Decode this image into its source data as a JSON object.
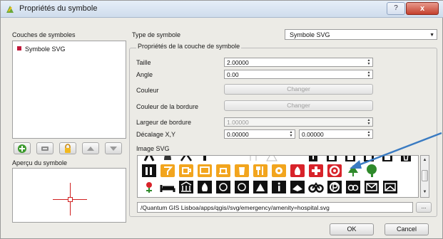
{
  "window": {
    "title": "Propriétés du symbole",
    "help_label": "?",
    "close_label": "x"
  },
  "left": {
    "layers_title": "Couches de symboles",
    "layers": [
      {
        "label": "Symbole SVG",
        "color": "#c0183a"
      }
    ],
    "tools": [
      "add-icon",
      "remove-icon",
      "lock-icon",
      "move-up-icon",
      "move-down-icon"
    ],
    "preview_title": "Aperçu du symbole"
  },
  "right": {
    "type_label": "Type de symbole",
    "type_value": "Symbole SVG",
    "layer_props_title": "Propriétés de la couche de symbole",
    "fields": {
      "size_label": "Taille",
      "size_value": "2.00000",
      "angle_label": "Angle",
      "angle_value": "0.00",
      "color_label": "Couleur",
      "color_button": "Changer",
      "border_color_label": "Couleur de la bordure",
      "border_color_button": "Changer",
      "border_width_label": "Largeur de bordure",
      "border_width_value": "1.00000",
      "offset_label": "Décalage X,Y",
      "offset_x": "0.00000",
      "offset_y": "0.00000"
    },
    "svg_image_label": "Image SVG",
    "svg_path": "/Quantum GIS Lisboa/apps/qgis//svg/emergency/amenity=hospital.svg",
    "browse_label": "..."
  },
  "buttons": {
    "ok": "OK",
    "cancel": "Cancel"
  },
  "svg_icons": {
    "row1": [
      "bell-icon",
      "figure-icon",
      "bar-icon",
      "blank-icon",
      "blank-icon",
      "blank-icon",
      "triangle-icon",
      "blank-icon",
      "blank-icon",
      "info-icon",
      "cup-icon",
      "bin-icon",
      "bin-icon",
      "bin-icon",
      "bin-icon"
    ],
    "row2": [
      "tools-icon",
      "cocktail-icon",
      "cup-icon",
      "tv-icon",
      "hat-icon",
      "beer-icon",
      "cutlery-icon",
      "cheese-icon",
      "fire-icon",
      "hospital-cross-icon",
      "lifebuoy-icon",
      "conifer-tree-icon",
      "deciduous-tree-icon"
    ],
    "row3": [
      "flower-icon",
      "bed-icon",
      "courthouse-icon",
      "fire-icon",
      "building-icon",
      "building-icon",
      "monument-icon",
      "info-icon",
      "book-icon",
      "bicycle-icon",
      "parking-icon",
      "cycle-parking-icon",
      "mailbox-icon",
      "envelope-icon"
    ]
  },
  "colors": {
    "icon_orange": "#f2a51e",
    "icon_black": "#111111",
    "icon_red": "#d8232a",
    "icon_green": "#2f8a2b",
    "annotation_blue": "#3a7bc2"
  }
}
